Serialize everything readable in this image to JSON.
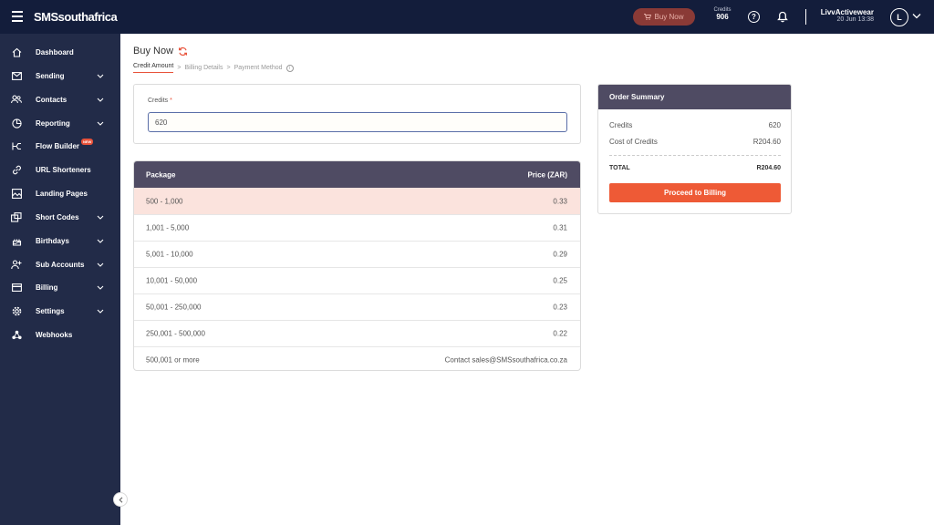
{
  "header": {
    "brand": "SMSsouthafrica",
    "buy_now_label": "Buy Now",
    "credits_label": "Credits",
    "credits_value": "906",
    "user_name": "LivvActivewear",
    "user_date": "20 Jun 13:38",
    "avatar_initial": "L"
  },
  "sidebar": {
    "items": [
      {
        "label": "Dashboard",
        "icon": "home-icon",
        "chevron": false
      },
      {
        "label": "Sending",
        "icon": "mail-icon",
        "chevron": true
      },
      {
        "label": "Contacts",
        "icon": "contacts-icon",
        "chevron": true
      },
      {
        "label": "Reporting",
        "icon": "pie-chart-icon",
        "chevron": true
      },
      {
        "label": "Flow Builder",
        "icon": "flow-icon",
        "chevron": false,
        "badge": "NEW"
      },
      {
        "label": "URL Shorteners",
        "icon": "link-icon",
        "chevron": false
      },
      {
        "label": "Landing Pages",
        "icon": "image-icon",
        "chevron": false
      },
      {
        "label": "Short Codes",
        "icon": "short-codes-icon",
        "chevron": true
      },
      {
        "label": "Birthdays",
        "icon": "cake-icon",
        "chevron": true
      },
      {
        "label": "Sub Accounts",
        "icon": "add-user-icon",
        "chevron": true
      },
      {
        "label": "Billing",
        "icon": "card-icon",
        "chevron": true
      },
      {
        "label": "Settings",
        "icon": "gear-icon",
        "chevron": true
      },
      {
        "label": "Webhooks",
        "icon": "webhook-icon",
        "chevron": false
      }
    ]
  },
  "page": {
    "title": "Buy Now",
    "steps": [
      "Credit Amount",
      "Billing Details",
      "Payment Method"
    ],
    "step_separator": ">"
  },
  "credits_form": {
    "label": "Credits",
    "required_mark": "*",
    "value": "620"
  },
  "package_table": {
    "headers": [
      "Package",
      "Price (ZAR)"
    ],
    "rows": [
      {
        "package": "500 - 1,000",
        "price": "0.33",
        "highlight": true
      },
      {
        "package": "1,001 - 5,000",
        "price": "0.31"
      },
      {
        "package": "5,001 - 10,000",
        "price": "0.29"
      },
      {
        "package": "10,001 - 50,000",
        "price": "0.25"
      },
      {
        "package": "50,001 - 250,000",
        "price": "0.23"
      },
      {
        "package": "250,001 - 500,000",
        "price": "0.22"
      },
      {
        "package": "500,001 or more",
        "price": "Contact sales@SMSsouthafrica.co.za"
      }
    ]
  },
  "order_summary": {
    "title": "Order Summary",
    "credits_label": "Credits",
    "credits_value": "620",
    "cost_label": "Cost of Credits",
    "cost_value": "R204.60",
    "total_label": "TOTAL",
    "total_value": "R204.60",
    "proceed_label": "Proceed to Billing"
  },
  "colors": {
    "topbar": "#131d3b",
    "sidebar": "#222b48",
    "accent": "#ee5a36",
    "table_header": "#4f4b63",
    "highlight_row": "#fbe3dd"
  }
}
